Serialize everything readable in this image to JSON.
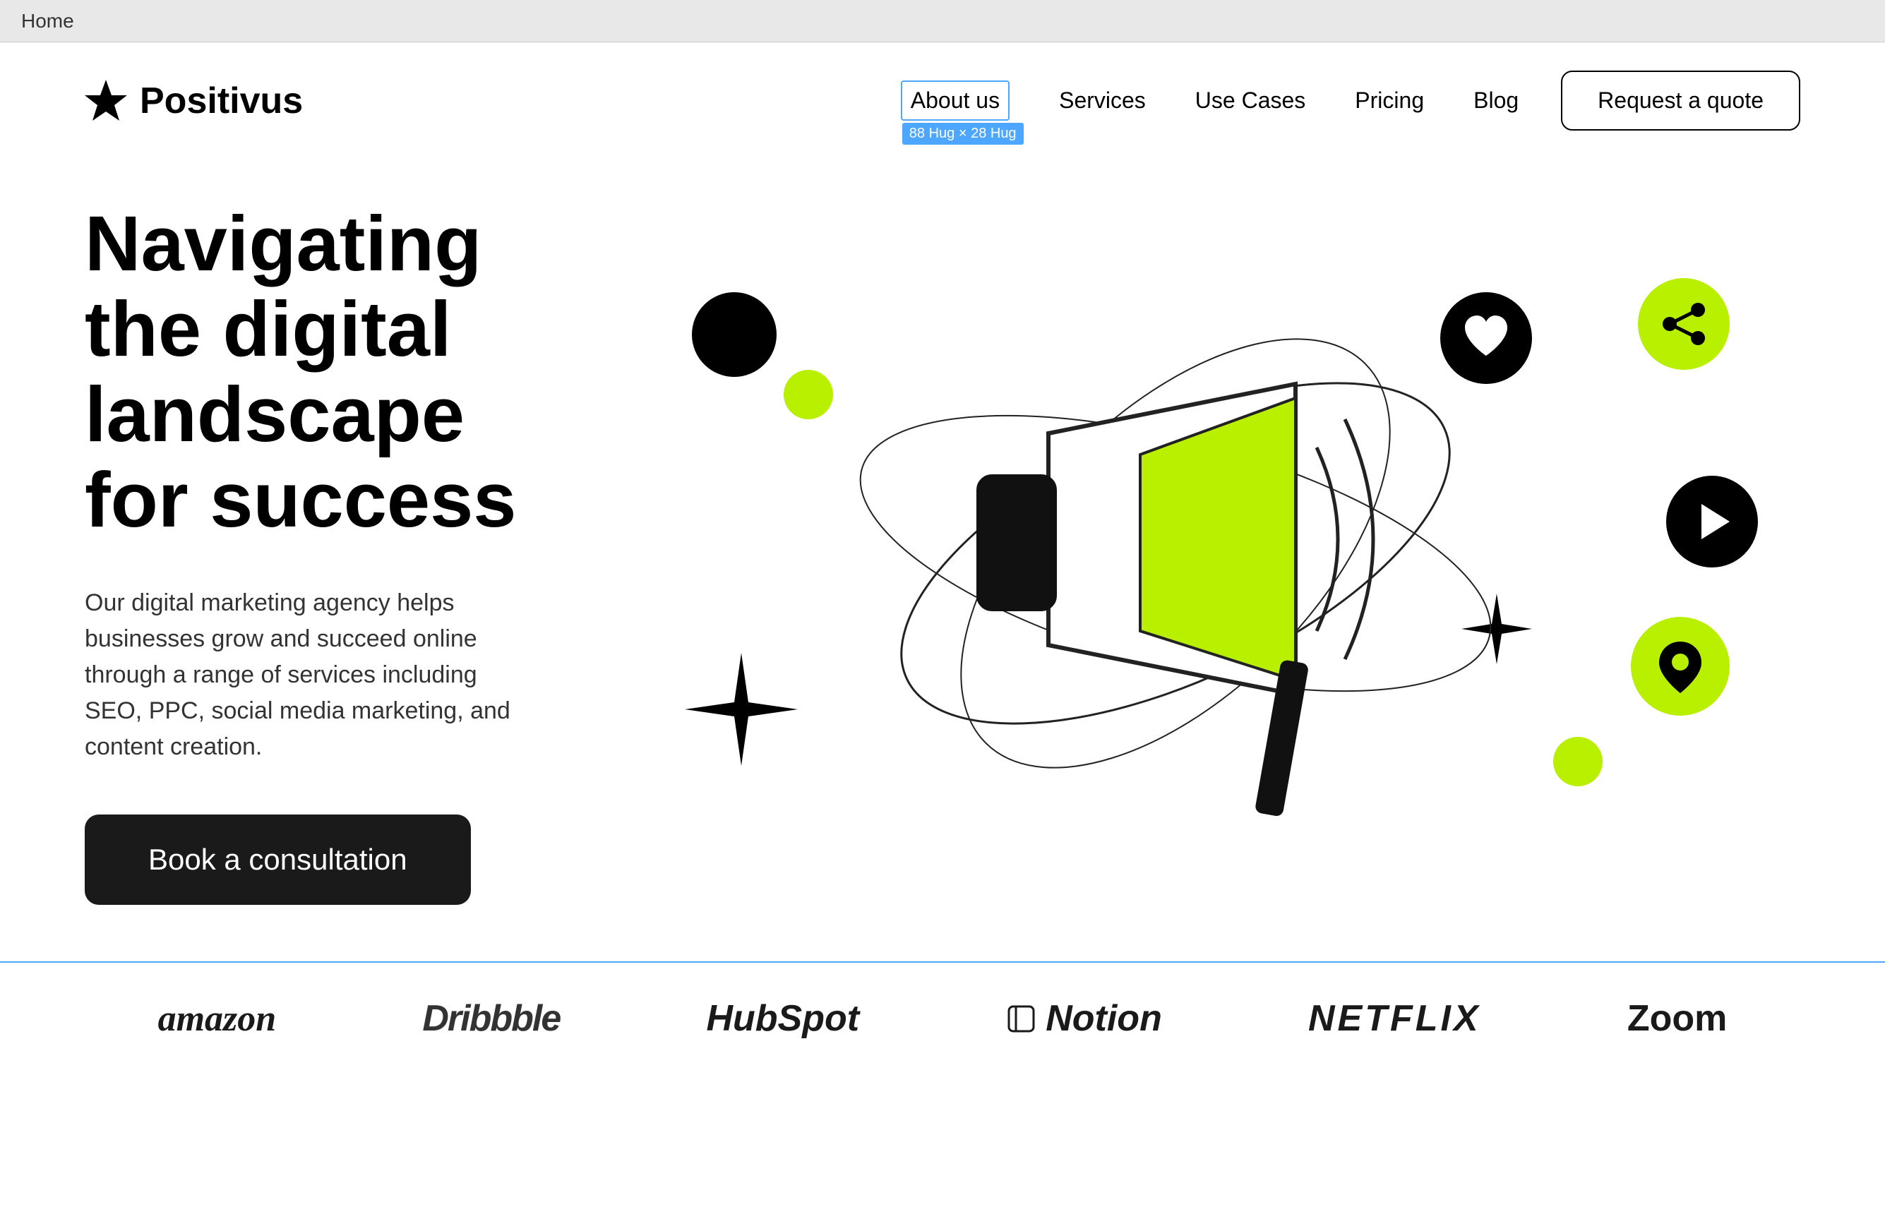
{
  "browser": {
    "tab_label": "Home"
  },
  "navbar": {
    "logo_text": "Positivus",
    "links": [
      {
        "id": "about-us",
        "label": "About us",
        "badge": "88 Hug × 28 Hug",
        "active": true
      },
      {
        "id": "services",
        "label": "Services"
      },
      {
        "id": "use-cases",
        "label": "Use Cases"
      },
      {
        "id": "pricing",
        "label": "Pricing"
      },
      {
        "id": "blog",
        "label": "Blog"
      }
    ],
    "cta_label": "Request a quote"
  },
  "hero": {
    "title": "Navigating the digital landscape for success",
    "description": "Our digital marketing agency helps businesses grow and succeed online through a range of services including SEO, PPC, social media marketing, and content creation.",
    "cta_label": "Book a consultation"
  },
  "brands": [
    {
      "id": "amazon",
      "label": "amazon"
    },
    {
      "id": "dribbble",
      "label": "Dribbble"
    },
    {
      "id": "hubspot",
      "label": "HubSpot"
    },
    {
      "id": "notion",
      "label": "Notion"
    },
    {
      "id": "netflix",
      "label": "NETFLIX"
    },
    {
      "id": "zoom",
      "label": "Zoom"
    }
  ],
  "icons": {
    "heart": "♥",
    "share": "⬆",
    "play": "▶",
    "location": "📍",
    "star_4pt": "✦"
  },
  "colors": {
    "accent_green": "#b8f000",
    "accent_blue": "#4da6ff",
    "dark": "#1a1a1a",
    "white": "#ffffff"
  }
}
